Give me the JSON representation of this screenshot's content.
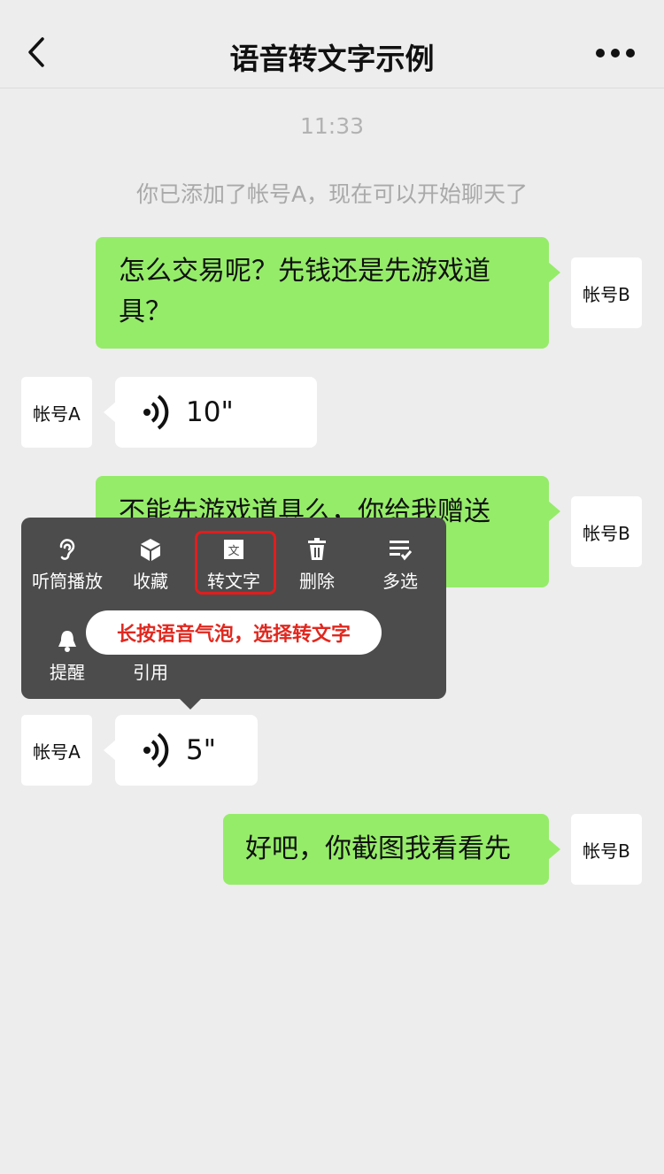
{
  "header": {
    "title": "语音转文字示例"
  },
  "chat": {
    "time": "11:33",
    "system_notice": "你已添加了帐号A，现在可以开始聊天了",
    "messages": [
      {
        "sender": "帐号B",
        "text": "怎么交易呢？先钱还是先游戏道具？"
      },
      {
        "sender": "帐号A",
        "voice_duration": "10\""
      },
      {
        "sender": "帐号B",
        "text": "不能先游戏道具么，你给我赠送"
      },
      {
        "sender": "帐号A",
        "voice_duration": "5\""
      },
      {
        "sender": "帐号B",
        "text": "好吧，你截图我看看先"
      }
    ]
  },
  "menu": {
    "items": [
      {
        "label": "听筒播放",
        "icon": "ear-icon"
      },
      {
        "label": "收藏",
        "icon": "cube-icon"
      },
      {
        "label": "转文字",
        "icon": "text-icon"
      },
      {
        "label": "删除",
        "icon": "trash-icon"
      },
      {
        "label": "多选",
        "icon": "list-check-icon"
      },
      {
        "label": "提醒",
        "icon": "bell-icon"
      },
      {
        "label": "引用",
        "icon": "quote-icon"
      }
    ],
    "highlight_color": "#e21d1d"
  },
  "tip": {
    "text": "长按语音气泡，选择转文字"
  },
  "colors": {
    "background": "#ededed",
    "bubble_green": "#95ec69",
    "menu_bg": "#4c4c4c",
    "tip_text": "#e0281f"
  }
}
